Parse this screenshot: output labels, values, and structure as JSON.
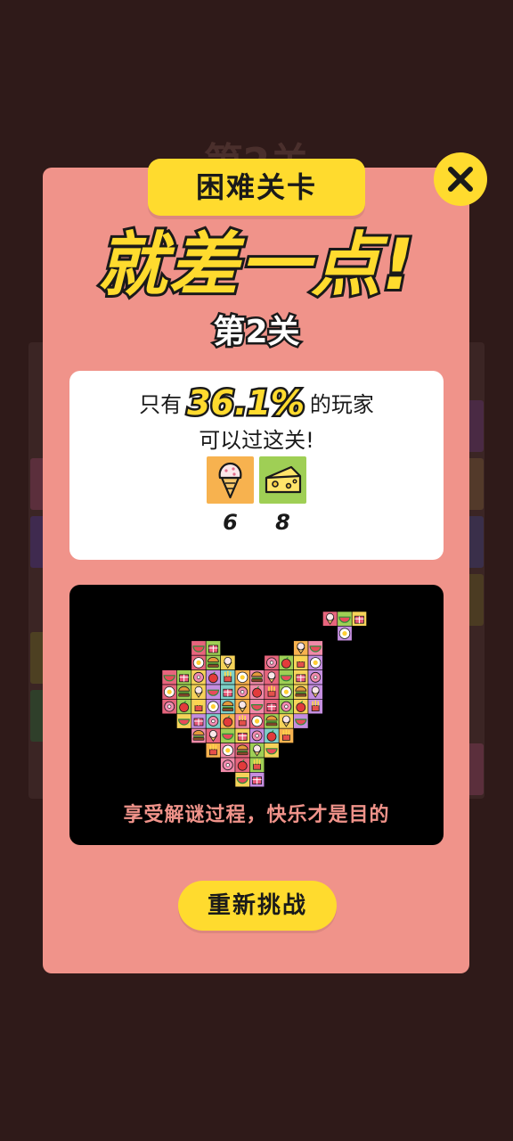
{
  "background": {
    "level_title": "第2关"
  },
  "modal": {
    "tag_label": "困难关卡",
    "close_icon": "close-icon",
    "headline": "就差一点!",
    "level_label": "第2关",
    "stats": {
      "prefix": "只有",
      "percent": "36.1%",
      "suffix": "的玩家",
      "line2": "可以过这关!",
      "items": [
        {
          "icon": "ice-cream-icon",
          "count": "6",
          "bg": "#f7b24f"
        },
        {
          "icon": "cheese-icon",
          "count": "8",
          "bg": "#9fcf55"
        }
      ]
    },
    "puzzle": {
      "caption": "享受解谜过程，快乐才是目的"
    },
    "retry_label": "重新挑战"
  },
  "colors": {
    "accent_yellow": "#ffdb2e",
    "modal_bg": "#f0938a",
    "backdrop": "#2f1a19"
  }
}
